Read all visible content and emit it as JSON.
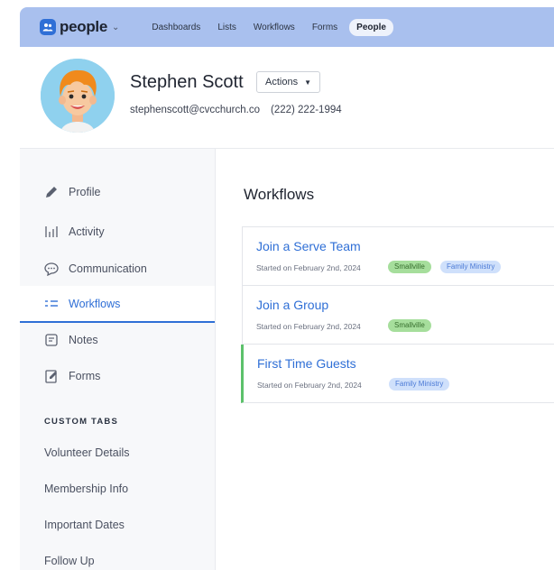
{
  "colors": {
    "nav_bg": "#a9c0ee",
    "accent": "#2f6fd6",
    "active_border": "#5cc16b",
    "tag_green": "#a6de9c",
    "tag_blue": "#cfe0fb"
  },
  "brand": {
    "name": "people",
    "icon": "people-app-icon"
  },
  "nav": {
    "items": [
      "Dashboards",
      "Lists",
      "Workflows",
      "Forms",
      "People"
    ],
    "active": "People"
  },
  "profile": {
    "name": "Stephen Scott",
    "actions_label": "Actions",
    "email": "stephenscott@cvcchurch.co",
    "phone": "(222) 222-1994"
  },
  "sidebar": {
    "items": [
      {
        "label": "Profile",
        "icon": "pencil-icon"
      },
      {
        "label": "Activity",
        "icon": "activity-bars-icon"
      },
      {
        "label": "Communication",
        "icon": "chat-bubble-icon"
      },
      {
        "label": "Workflows",
        "icon": "workflows-list-icon",
        "active": true
      },
      {
        "label": "Notes",
        "icon": "notes-icon"
      },
      {
        "label": "Forms",
        "icon": "forms-icon"
      }
    ],
    "custom_heading": "CUSTOM TABS",
    "custom_items": [
      "Volunteer Details",
      "Membership Info",
      "Important Dates",
      "Follow Up"
    ]
  },
  "main": {
    "title": "Workflows",
    "workflows": [
      {
        "title": "Join a Serve Team",
        "started": "Started on February 2nd, 2024",
        "tags": [
          "Smallville",
          "Family Ministry"
        ]
      },
      {
        "title": "Join a Group",
        "started": "Started on February 2nd, 2024",
        "tags": [
          "Smallville"
        ]
      },
      {
        "title": "First Time Guests",
        "started": "Started on February 2nd, 2024",
        "tags": [
          "Family Ministry"
        ]
      }
    ]
  }
}
